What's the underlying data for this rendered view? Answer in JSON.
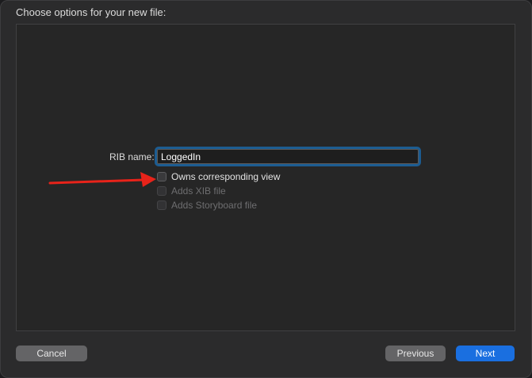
{
  "header": {
    "title": "Choose options for your new file:"
  },
  "form": {
    "name_label": "RIB name:",
    "name_value": "LoggedIn",
    "checkboxes": [
      {
        "label": "Owns corresponding view",
        "checked": false,
        "enabled": true
      },
      {
        "label": "Adds XIB file",
        "checked": false,
        "enabled": false
      },
      {
        "label": "Adds Storyboard file",
        "checked": false,
        "enabled": false
      }
    ]
  },
  "annotation": {
    "arrow_color": "#e8231a"
  },
  "footer": {
    "cancel_label": "Cancel",
    "previous_label": "Previous",
    "next_label": "Next"
  },
  "colors": {
    "accent": "#1a6fe0",
    "focus_ring": "#1c5c91"
  }
}
